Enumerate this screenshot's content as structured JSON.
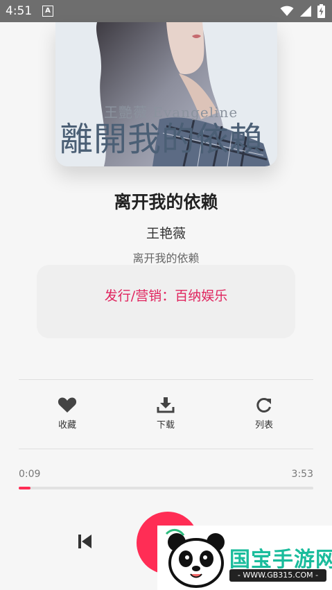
{
  "status_bar": {
    "time": "4:51",
    "notification_icon": "a-box-icon",
    "icons": [
      "wifi-icon",
      "signal-icon",
      "battery-charging-icon"
    ]
  },
  "cover": {
    "subtitle_text": "王艷薇 Evangeline",
    "title_text": "離開我的依賴"
  },
  "song": {
    "title": "离开我的依赖",
    "artist": "王艳薇",
    "album": "离开我的依赖"
  },
  "info_card": {
    "text": "发行/营销：百纳娱乐"
  },
  "actions": {
    "favorite": {
      "label": "收藏",
      "icon": "heart-icon"
    },
    "download": {
      "label": "下载",
      "icon": "download-icon"
    },
    "list": {
      "label": "列表",
      "icon": "refresh-icon"
    }
  },
  "player": {
    "current_time": "0:09",
    "total_time": "3:53",
    "progress_fraction": 0.039,
    "prev_icon": "skip-previous-icon",
    "play_icon": "play-icon"
  },
  "watermark": {
    "brand": "国宝手游网",
    "url": "- WWW.GB315.COM -"
  },
  "colors": {
    "accent": "#ff2d55",
    "info_text": "#e0245e",
    "status_bar": "#6e6e6e"
  }
}
